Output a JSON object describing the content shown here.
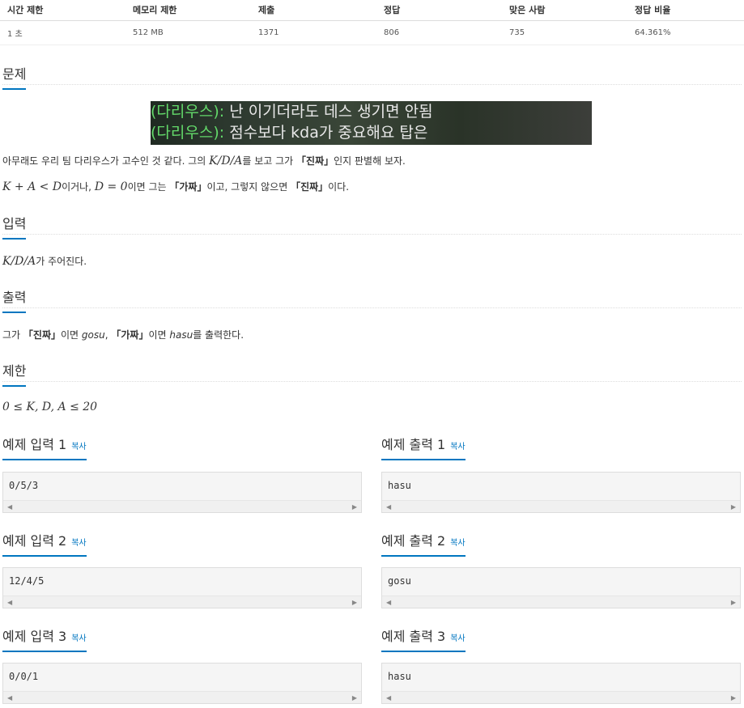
{
  "info": {
    "headers": [
      "시간 제한",
      "메모리 제한",
      "제출",
      "정답",
      "맞은 사람",
      "정답 비율"
    ],
    "values": [
      "1 초",
      "512 MB",
      "1371",
      "806",
      "735",
      "64.361%"
    ]
  },
  "sections": {
    "problem": "문제",
    "input": "입력",
    "output": "출력",
    "limit": "제한"
  },
  "banner": {
    "line1_name": "(다리우스):",
    "line1_msg": "난 이기더라도 데스 생기면 안됨",
    "line2_name": "(다리우스):",
    "line2_msg": "점수보다 kda가 중요해요 탑은"
  },
  "problem": {
    "p1_a": "아무래도 우리 팀 다리우스가 고수인 것 같다. 그의 ",
    "p1_math": "K/D/A",
    "p1_b": "를 보고 그가 ",
    "p1_q": "「진짜」",
    "p1_c": "인지 판별해 보자.",
    "p2_math1": "K + A < D",
    "p2_a": "이거나, ",
    "p2_math2": "D = 0",
    "p2_b": "이면 그는 ",
    "p2_q1": "「가짜」",
    "p2_c": "이고, 그렇지 않으면 ",
    "p2_q2": "「진짜」",
    "p2_d": "이다."
  },
  "input_desc": {
    "math": "K/D/A",
    "text": "가 주어진다."
  },
  "output_desc": {
    "a": "그가 ",
    "q1": "「진짜」",
    "b": "이면 ",
    "w1": "gosu",
    "c": ", ",
    "q2": "「가짜」",
    "d": "이면 ",
    "w2": "hasu",
    "e": "를 출력한다."
  },
  "limit_desc": {
    "math": "0 ≤ K, D, A ≤ 20"
  },
  "copy_label": "복사",
  "samples": [
    {
      "in_title": "예제 입력 1",
      "in_value": "0/5/3",
      "out_title": "예제 출력 1",
      "out_value": "hasu"
    },
    {
      "in_title": "예제 입력 2",
      "in_value": "12/4/5",
      "out_title": "예제 출력 2",
      "out_value": "gosu"
    },
    {
      "in_title": "예제 입력 3",
      "in_value": "0/0/1",
      "out_title": "예제 출력 3",
      "out_value": "hasu"
    }
  ],
  "colors": {
    "accent": "#0076c0",
    "banner_name": "#63d96a"
  }
}
